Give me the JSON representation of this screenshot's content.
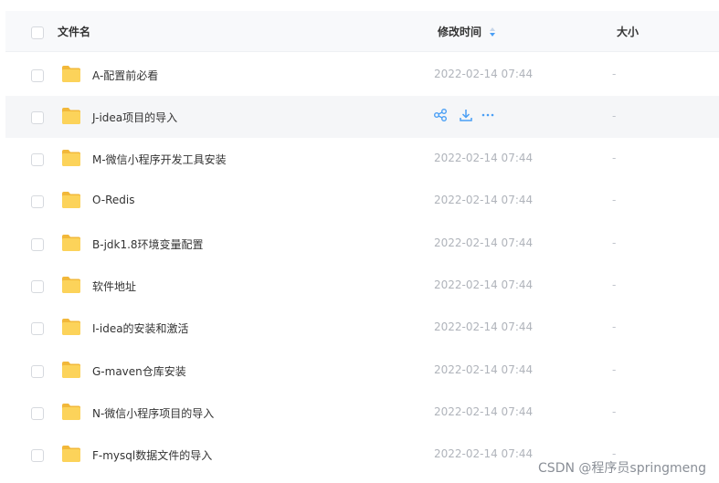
{
  "header": {
    "name_label": "文件名",
    "time_label": "修改时间",
    "size_label": "大小"
  },
  "files": [
    {
      "name": "A-配置前必看",
      "time": "2022-02-14 07:44",
      "size": "-"
    },
    {
      "name": "J-idea项目的导入",
      "time": "2022-02-14 07:44",
      "size": "-"
    },
    {
      "name": "M-微信小程序开发工具安装",
      "time": "2022-02-14 07:44",
      "size": "-"
    },
    {
      "name": "O-Redis",
      "time": "2022-02-14 07:44",
      "size": "-"
    },
    {
      "name": "B-jdk1.8环境变量配置",
      "time": "2022-02-14 07:44",
      "size": "-"
    },
    {
      "name": "软件地址",
      "time": "2022-02-14 07:44",
      "size": "-"
    },
    {
      "name": "I-idea的安装和激活",
      "time": "2022-02-14 07:44",
      "size": "-"
    },
    {
      "name": "G-maven仓库安装",
      "time": "2022-02-14 07:44",
      "size": "-"
    },
    {
      "name": "N-微信小程序项目的导入",
      "time": "2022-02-14 07:44",
      "size": "-"
    },
    {
      "name": "F-mysql数据文件的导入",
      "time": "2022-02-14 07:44",
      "size": "-"
    }
  ],
  "hover_row_actions": [
    "share-icon",
    "download-icon",
    "more-icon"
  ],
  "colors": {
    "folder": "#f7c948",
    "accent": "#4a9ff5",
    "header_bg": "#f8f9fb",
    "hover_bg": "#f5f6f8"
  },
  "watermark": "CSDN @程序员springmeng"
}
